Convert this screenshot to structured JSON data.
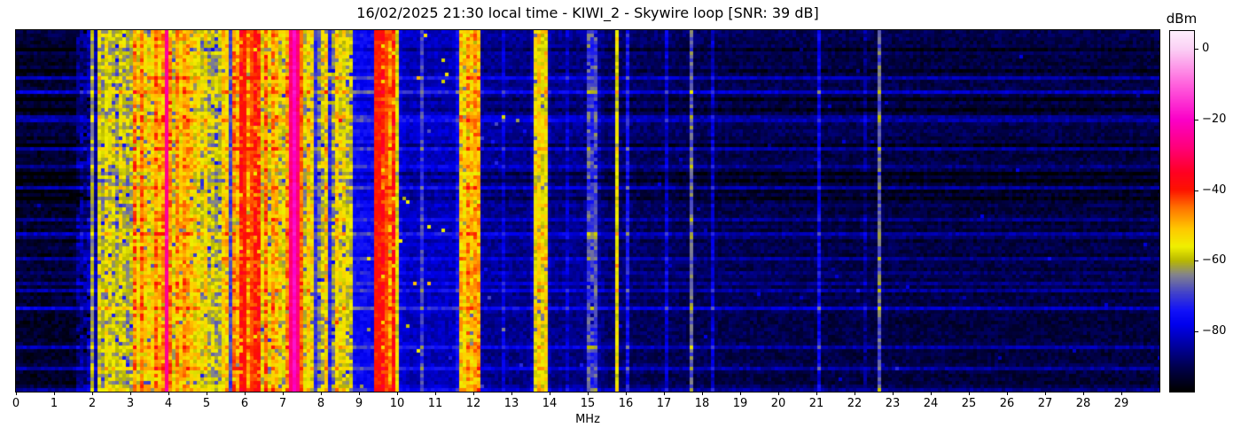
{
  "title": "16/02/2025 21:30 local time - KIWI_2 - Skywire loop [SNR: 39 dB]",
  "x_axis": {
    "label": "MHz",
    "min": 0,
    "max": 30,
    "ticks": [
      0,
      1,
      2,
      3,
      4,
      5,
      6,
      7,
      8,
      9,
      10,
      11,
      12,
      13,
      14,
      15,
      16,
      17,
      18,
      19,
      20,
      21,
      22,
      23,
      24,
      25,
      26,
      27,
      28,
      29
    ]
  },
  "y_axis": {
    "label": "",
    "ticks": []
  },
  "colorbar": {
    "label": "dBm",
    "vmin": -97,
    "vmax": 5,
    "ticks": [
      {
        "value": 0,
        "label": "0"
      },
      {
        "value": -20,
        "label": "−20"
      },
      {
        "value": -40,
        "label": "−40"
      },
      {
        "value": -60,
        "label": "−60"
      },
      {
        "value": -80,
        "label": "−80"
      }
    ],
    "colormap": [
      [
        0.0,
        "#000000"
      ],
      [
        0.069,
        "#000050"
      ],
      [
        0.127,
        "#0000a0"
      ],
      [
        0.186,
        "#0000ee"
      ],
      [
        0.225,
        "#1212f8"
      ],
      [
        0.275,
        "#4444c8"
      ],
      [
        0.324,
        "#84848c"
      ],
      [
        0.363,
        "#b8b800"
      ],
      [
        0.402,
        "#f0f000"
      ],
      [
        0.451,
        "#ffc800"
      ],
      [
        0.51,
        "#ff7300"
      ],
      [
        0.559,
        "#fd1300"
      ],
      [
        0.608,
        "#ff0022"
      ],
      [
        0.676,
        "#ff0078"
      ],
      [
        0.755,
        "#fb00c8"
      ],
      [
        0.853,
        "#ff62dd"
      ],
      [
        0.951,
        "#fbd0f5"
      ],
      [
        1.0,
        "#fdeffc"
      ]
    ]
  },
  "chart_data": {
    "type": "heatmap",
    "title": "16/02/2025 21:30 local time - KIWI_2 - Skywire loop [SNR: 39 dB]",
    "xlabel": "MHz",
    "x_range": [
      0,
      30
    ],
    "value_unit": "dBm",
    "value_range": [
      -97,
      5
    ],
    "grid": false,
    "legend": false,
    "snr_db": 39,
    "noise_floor_dbm": [
      [
        0,
        -93
      ],
      [
        1.55,
        -93
      ],
      [
        1.62,
        -88
      ],
      [
        1.95,
        -90
      ],
      [
        2.08,
        -84
      ],
      [
        2.6,
        -83
      ],
      [
        3.0,
        -79
      ],
      [
        3.4,
        -73
      ],
      [
        3.8,
        -70
      ],
      [
        4.3,
        -68
      ],
      [
        4.9,
        -71
      ],
      [
        5.5,
        -72
      ],
      [
        5.75,
        -67
      ],
      [
        6.9,
        -66
      ],
      [
        7.6,
        -70
      ],
      [
        8.2,
        -73
      ],
      [
        8.9,
        -76
      ],
      [
        9.35,
        -77
      ],
      [
        9.45,
        -71
      ],
      [
        9.9,
        -73
      ],
      [
        10.1,
        -80
      ],
      [
        10.3,
        -82
      ],
      [
        11.5,
        -82
      ],
      [
        11.62,
        -74
      ],
      [
        12.1,
        -75
      ],
      [
        12.25,
        -85
      ],
      [
        13.5,
        -86
      ],
      [
        13.58,
        -79
      ],
      [
        13.88,
        -80
      ],
      [
        14.05,
        -86
      ],
      [
        14.95,
        -86
      ],
      [
        15.05,
        -83
      ],
      [
        15.25,
        -84
      ],
      [
        15.45,
        -88
      ],
      [
        16.5,
        -89
      ],
      [
        18.5,
        -90
      ],
      [
        20.0,
        -90.5
      ],
      [
        23.0,
        -91
      ],
      [
        30.0,
        -91.5
      ]
    ],
    "stripe_zones": [
      {
        "f0": 1.62,
        "f1": 1.92,
        "count": 4,
        "lmin": -87,
        "lmax": -83
      },
      {
        "f0": 2.1,
        "f1": 3.05,
        "count": 13,
        "lmin": -64,
        "lmax": -53
      },
      {
        "f0": 3.05,
        "f1": 4.5,
        "count": 26,
        "lmin": -60,
        "lmax": -44
      },
      {
        "f0": 4.5,
        "f1": 5.6,
        "count": 14,
        "lmin": -62,
        "lmax": -50
      },
      {
        "f0": 5.65,
        "f1": 6.35,
        "count": 11,
        "lmin": -50,
        "lmax": -38
      },
      {
        "f0": 6.4,
        "f1": 7.2,
        "count": 13,
        "lmin": -58,
        "lmax": -45
      },
      {
        "f0": 7.5,
        "f1": 8.9,
        "count": 15,
        "lmin": -64,
        "lmax": -52
      },
      {
        "f0": 9.42,
        "f1": 9.95,
        "count": 9,
        "lmin": -48,
        "lmax": -39
      },
      {
        "f0": 11.62,
        "f1": 12.15,
        "count": 9,
        "lmin": -57,
        "lmax": -46
      },
      {
        "f0": 13.55,
        "f1": 13.9,
        "count": 6,
        "lmin": -59,
        "lmax": -50
      },
      {
        "f0": 15.0,
        "f1": 15.28,
        "count": 3,
        "lmin": -74,
        "lmax": -68
      }
    ],
    "carriers": [
      {
        "f": 2.02,
        "level": -62,
        "w": 1
      },
      {
        "f": 3.94,
        "level": -25,
        "w": 1
      },
      {
        "f": 5.93,
        "level": -40,
        "w": 2
      },
      {
        "f": 6.18,
        "level": -43,
        "w": 1
      },
      {
        "f": 7.33,
        "level": -20,
        "w": 3
      },
      {
        "f": 7.52,
        "level": -45,
        "w": 1
      },
      {
        "f": 8.16,
        "level": -53,
        "w": 1
      },
      {
        "f": 9.53,
        "level": -40,
        "w": 2
      },
      {
        "f": 9.74,
        "level": -43,
        "w": 1
      },
      {
        "f": 10.03,
        "level": -57,
        "w": 1
      },
      {
        "f": 10.62,
        "level": -70,
        "w": 1
      },
      {
        "f": 12.8,
        "level": -80,
        "w": 1
      },
      {
        "f": 14.5,
        "level": -81,
        "w": 1
      },
      {
        "f": 15.75,
        "level": -56,
        "w": 1
      },
      {
        "f": 16.05,
        "level": -75,
        "w": 1
      },
      {
        "f": 17.05,
        "level": -80,
        "w": 1
      },
      {
        "f": 17.72,
        "level": -66,
        "w": 1
      },
      {
        "f": 18.3,
        "level": -81,
        "w": 1
      },
      {
        "f": 21.1,
        "level": -77,
        "w": 1
      },
      {
        "f": 22.25,
        "level": -86,
        "w": 1
      },
      {
        "f": 22.67,
        "level": -67,
        "w": 1
      }
    ],
    "speckle_zones": [
      {
        "f0": 8.0,
        "f1": 9.35,
        "prob": 0.004,
        "boost": 16
      },
      {
        "f0": 10.05,
        "f1": 11.55,
        "prob": 0.006,
        "boost": 26
      },
      {
        "f0": 12.2,
        "f1": 13.5,
        "prob": 0.003,
        "boost": 14
      },
      {
        "f0": 0,
        "f1": 30,
        "prob": 0.0015,
        "boost": 10
      }
    ]
  }
}
